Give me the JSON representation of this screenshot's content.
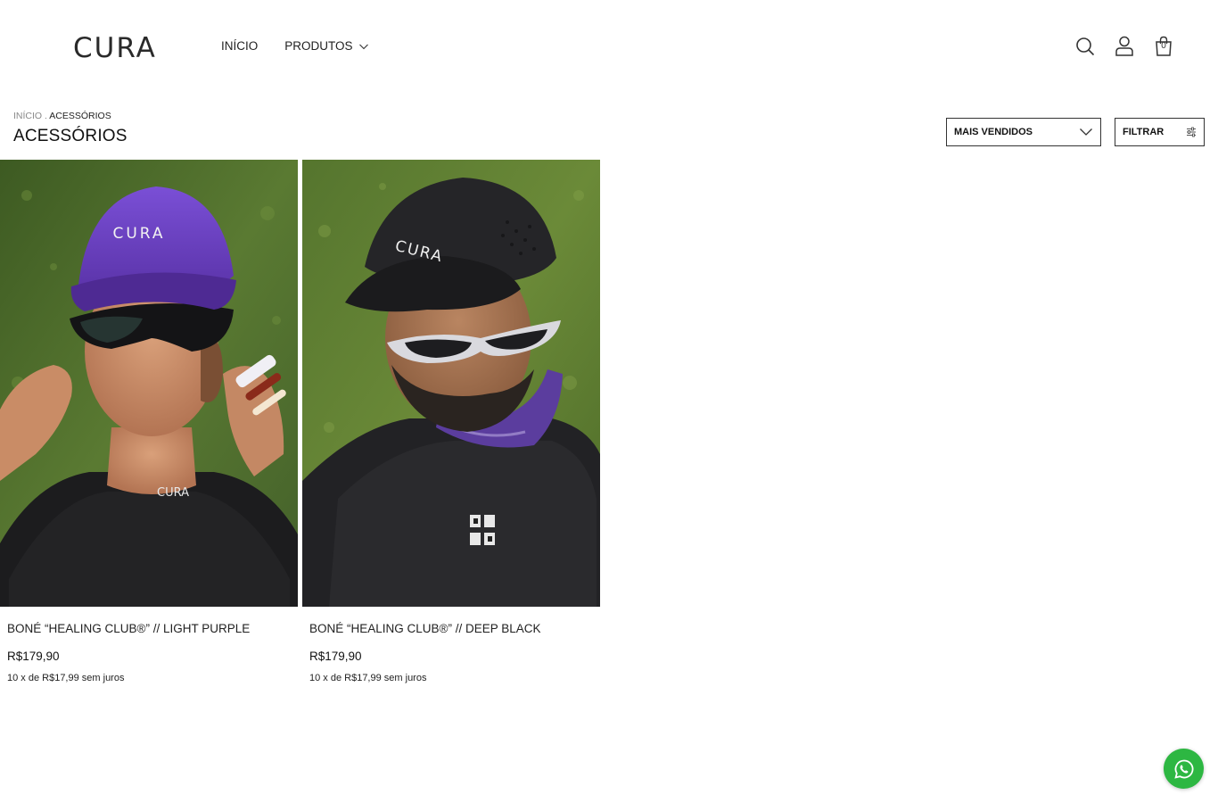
{
  "header": {
    "logo": "CURA",
    "nav": [
      {
        "label": "INÍCIO"
      },
      {
        "label": "PRODUTOS"
      }
    ],
    "icons": [
      "search-icon",
      "user-icon",
      "bag-icon"
    ],
    "cart_count": "0"
  },
  "breadcrumb": {
    "home": "INÍCIO",
    "separator": ".",
    "current": "ACESSÓRIOS"
  },
  "page": {
    "title": "ACESSÓRIOS"
  },
  "controls": {
    "sort_label": "MAIS VENDIDOS",
    "filter_label": "FILTRAR"
  },
  "products": [
    {
      "name": "BONÉ “HEALING CLUB®” // LIGHT PURPLE",
      "price": "R$179,90",
      "installments": "10 x de R$17,99 sem juros",
      "cap_text": "CURA",
      "shirt_text": "CURA"
    },
    {
      "name": "BONÉ “HEALING CLUB®” // DEEP BLACK",
      "price": "R$179,90",
      "installments": "10 x de R$17,99 sem juros",
      "cap_text": "CURA"
    }
  ],
  "colors": {
    "whatsapp": "#2db742",
    "purple_cap": "#6a3fc0",
    "grass": "#4a6a2c"
  }
}
